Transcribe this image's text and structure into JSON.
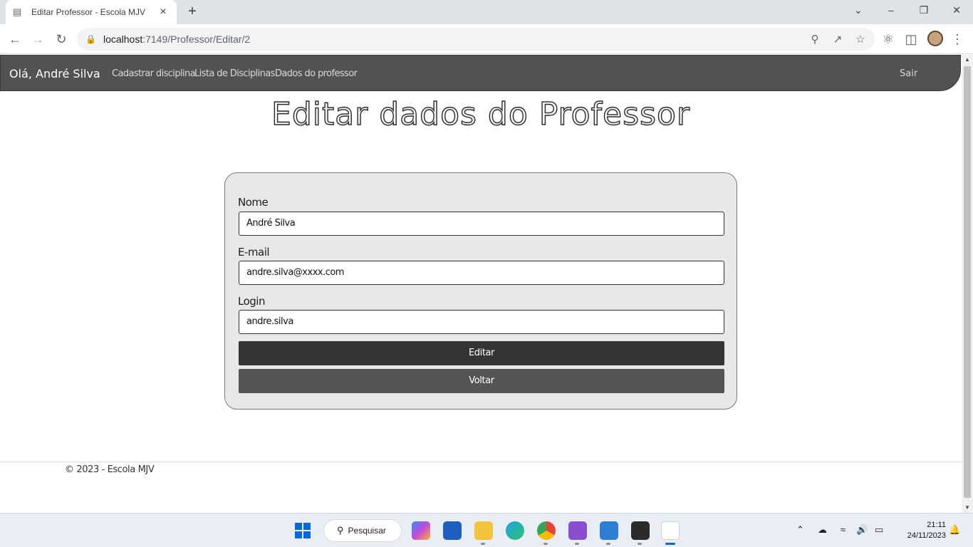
{
  "browser": {
    "tab_title": "Editar Professor - Escola MJV",
    "url_host": "localhost",
    "url_path": ":7149/Professor/Editar/2"
  },
  "navbar": {
    "brand": "Olá, André Silva",
    "links": [
      "Cadastrar disciplina",
      "Lista de Disciplinas",
      "Dados do professor"
    ],
    "logout": "Sair"
  },
  "page": {
    "title": "Editar dados do Professor"
  },
  "form": {
    "fields": [
      {
        "label": "Nome",
        "value": "André Silva"
      },
      {
        "label": "E-mail",
        "value": "andre.silva@xxxx.com"
      },
      {
        "label": "Login",
        "value": "andre.silva"
      }
    ],
    "edit_button": "Editar",
    "back_button": "Voltar"
  },
  "footer": {
    "text": "© 2023 - Escola MJV"
  },
  "taskbar": {
    "search_label": "Pesquisar",
    "time": "21:11",
    "date": "24/11/2023"
  }
}
